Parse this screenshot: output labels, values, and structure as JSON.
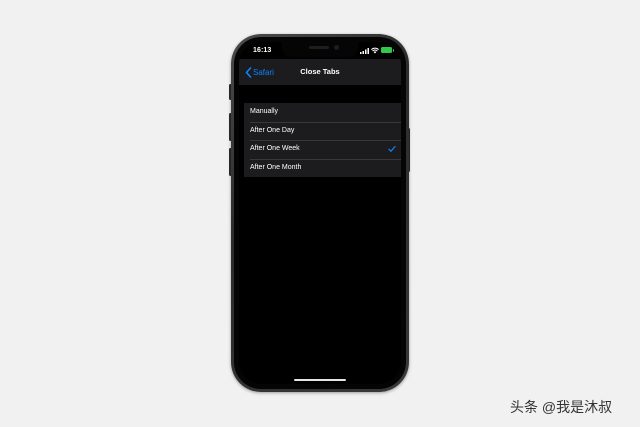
{
  "status_bar": {
    "time": "16:13",
    "icons": [
      "signal-icon",
      "wifi-icon",
      "battery-icon"
    ],
    "battery_color": "#30c94c"
  },
  "nav": {
    "back_label": "Safari",
    "title": "Close Tabs",
    "back_icon": "chevron-left-icon",
    "accent_color": "#0a84ff"
  },
  "options": [
    {
      "label": "Manually",
      "selected": false
    },
    {
      "label": "After One Day",
      "selected": false
    },
    {
      "label": "After One Week",
      "selected": true
    },
    {
      "label": "After One Month",
      "selected": false
    }
  ],
  "watermark": {
    "text": "头条 @我是沐叔"
  }
}
